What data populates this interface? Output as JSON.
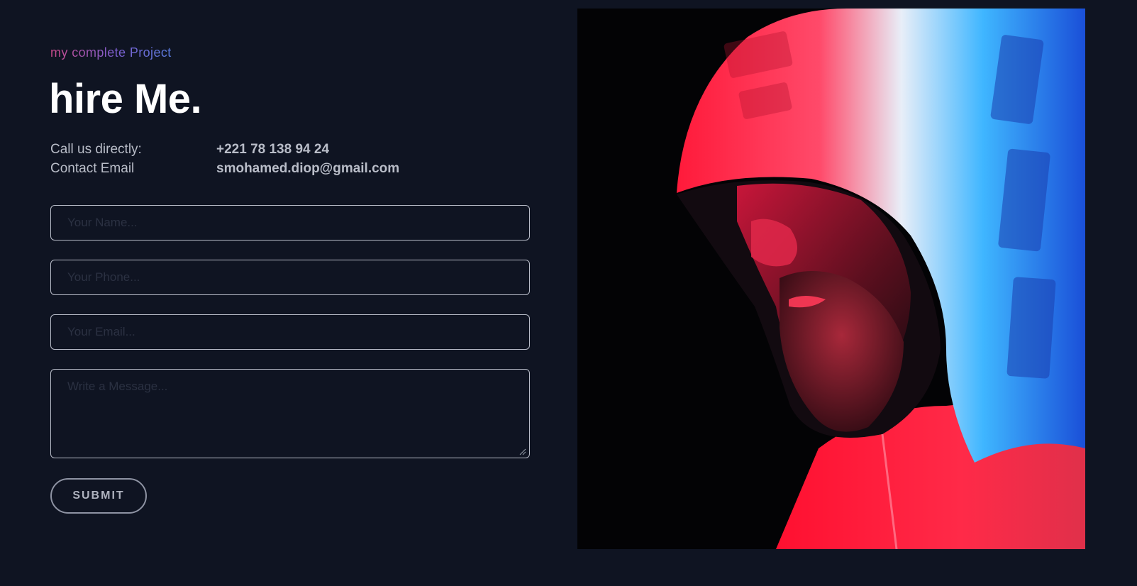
{
  "section": {
    "eyebrow": "my complete Project",
    "title": "hire Me."
  },
  "contact": {
    "phone_label": "Call us directly:",
    "phone_value": "+221 78 138 94 24",
    "email_label": "Contact Email",
    "email_value": "smohamed.diop@gmail.com"
  },
  "form": {
    "name_placeholder": "Your Name...",
    "phone_placeholder": "Your Phone...",
    "email_placeholder": "Your Email...",
    "message_placeholder": "Write a Message...",
    "submit_label": "SUBMIT"
  },
  "colors": {
    "background": "#0f1422",
    "accent_start": "#c94a8a",
    "accent_end": "#5a7de0"
  },
  "photo": {
    "icon": "hooded-man-photo"
  }
}
